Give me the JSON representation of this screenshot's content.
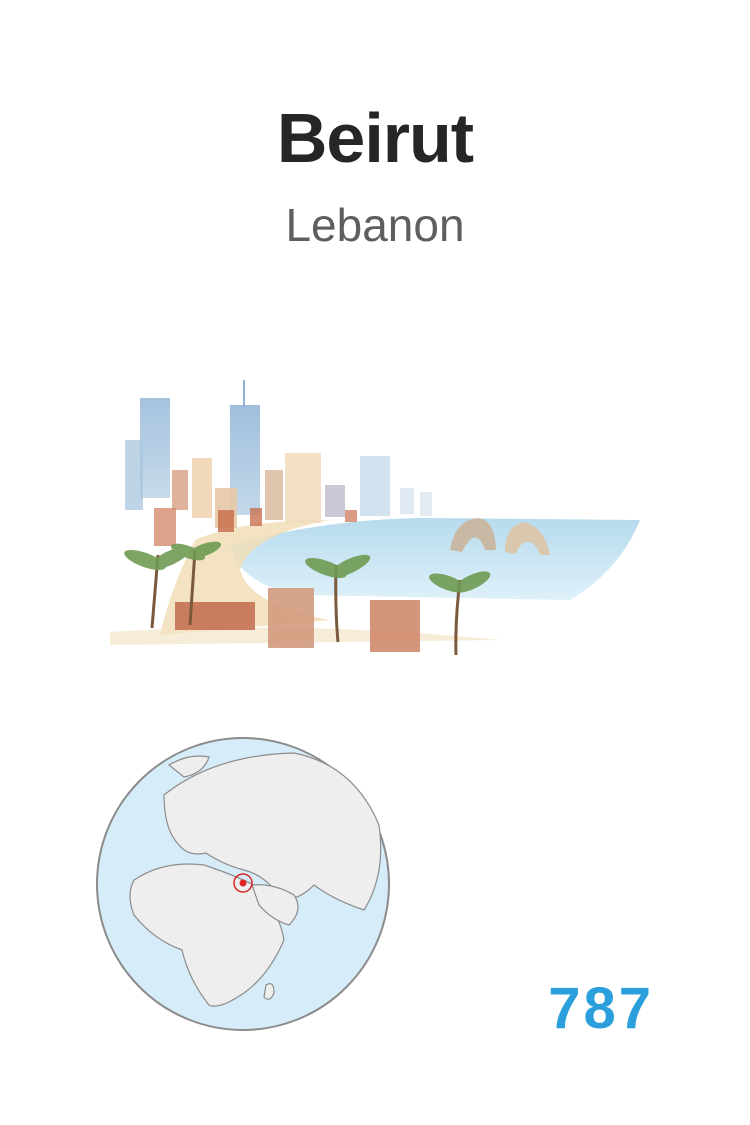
{
  "card": {
    "city": "Beirut",
    "country": "Lebanon",
    "number": "787"
  },
  "illustration": {
    "subject": "watercolor Beirut skyline with corniche, palm trees and Pigeon Rocks"
  },
  "globe": {
    "marker_color": "#e02424",
    "ocean_color": "#d6ecf8",
    "land_color": "#eeeeee"
  },
  "colors": {
    "number_accent": "#2a9fdc",
    "title": "#262626",
    "subtitle": "#5e5e5e"
  }
}
